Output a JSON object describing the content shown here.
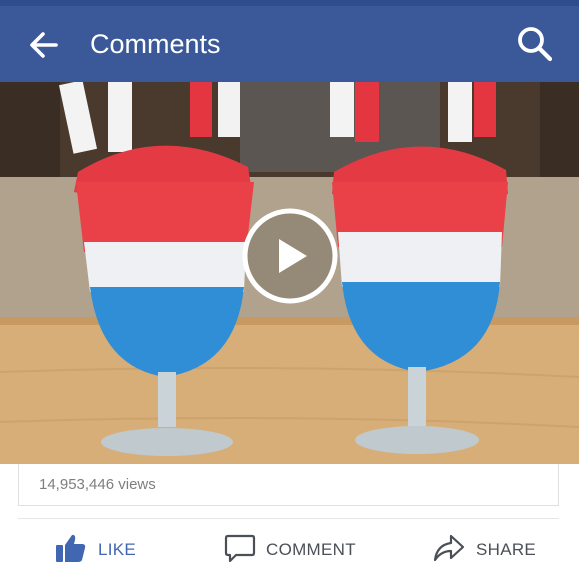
{
  "header": {
    "title": "Comments",
    "back_icon": "arrow-left-icon",
    "search_icon": "search-icon"
  },
  "video": {
    "play_icon": "play-icon"
  },
  "stats": {
    "views": "14,953,446 views"
  },
  "actions": {
    "like": "LIKE",
    "comment": "COMMENT",
    "share": "SHARE"
  },
  "colors": {
    "brand": "#3b5998",
    "like_active": "#4267b2",
    "action_text": "#4b4f56",
    "views_text": "#7f7f7f"
  }
}
